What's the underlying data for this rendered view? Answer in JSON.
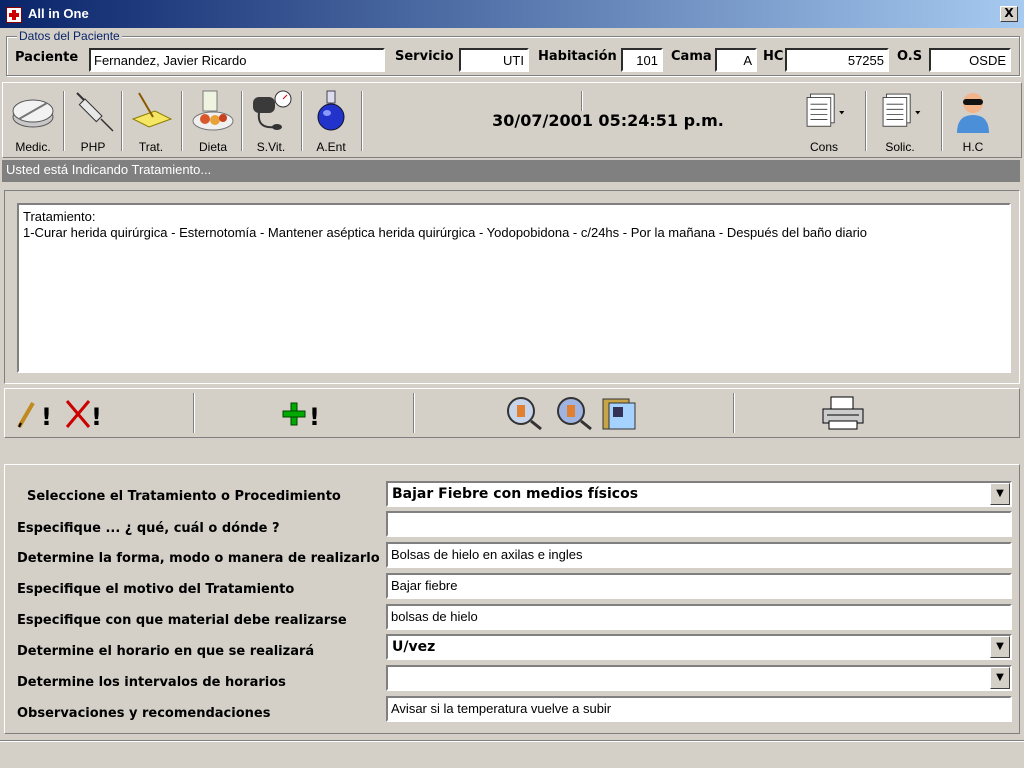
{
  "window": {
    "title": "All in One",
    "close_label": "X"
  },
  "patient": {
    "group_title": "Datos del Paciente",
    "labels": {
      "paciente": "Paciente",
      "servicio": "Servicio",
      "habitacion": "Habitación",
      "cama": "Cama",
      "hc": "HC",
      "os": "O.S"
    },
    "values": {
      "paciente": "Fernandez, Javier Ricardo",
      "servicio": "UTI",
      "habitacion": "101",
      "cama": "A",
      "hc": "57255",
      "os": "OSDE"
    }
  },
  "toolbar": {
    "tools": [
      {
        "label": "Medic.",
        "icon": "pill-icon"
      },
      {
        "label": "PHP",
        "icon": "syringe-icon"
      },
      {
        "label": "Trat.",
        "icon": "bandage-icon"
      },
      {
        "label": "Dieta",
        "icon": "food-icon"
      },
      {
        "label": "S.Vit.",
        "icon": "blood-pressure-icon"
      },
      {
        "label": "A.Ent",
        "icon": "flask-icon"
      }
    ],
    "datetime": "30/07/2001 05:24:51 p.m.",
    "right_tools": [
      {
        "label": "Cons",
        "icon": "documents-icon"
      },
      {
        "label": "Solic.",
        "icon": "documents-icon"
      },
      {
        "label": "H.C",
        "icon": "doctor-icon"
      }
    ]
  },
  "status": {
    "text": "Usted está Indicando Tratamiento..."
  },
  "treatment": {
    "line1": "Tratamiento:",
    "line2": "1-Curar herida quirúrgica - Esternotomía - Mantener aséptica herida quirúrgica - Yodopobidona - c/24hs - Por la mañana - Después del baño diario"
  },
  "actions": {
    "edit_glyph": "!",
    "delete_glyph": "!",
    "add_glyph": "!"
  },
  "form": {
    "fields": [
      {
        "label": "Seleccione el Tratamiento o Procedimiento",
        "value": "Bajar Fiebre con medios físicos",
        "kind": "select"
      },
      {
        "label": "Especifique ... ¿ qué, cuál o dónde ?",
        "value": "",
        "kind": "input"
      },
      {
        "label": "Determine la forma, modo o manera de realizarlo",
        "value": "Bolsas de hielo en axilas e ingles",
        "kind": "input"
      },
      {
        "label": "Especifique el motivo del Tratamiento",
        "value": "Bajar fiebre",
        "kind": "input"
      },
      {
        "label": "Especifique con que material debe realizarse",
        "value": "bolsas de hielo",
        "kind": "input"
      },
      {
        "label": "Determine el horario en que se realizará",
        "value": "U/vez",
        "kind": "select"
      },
      {
        "label": "Determine los intervalos de horarios",
        "value": "",
        "kind": "select"
      },
      {
        "label": "Observaciones y recomendaciones",
        "value": "Avisar si la temperatura vuelve a subir",
        "kind": "input"
      }
    ]
  },
  "colors": {
    "titlebar_start": "#0a246a",
    "titlebar_end": "#a6caf0",
    "face": "#d4d0c8",
    "status_bg": "#808080"
  }
}
